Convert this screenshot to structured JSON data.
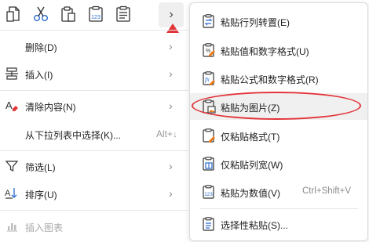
{
  "toolbar": {
    "icons": [
      "paste-icon",
      "cut-icon",
      "clipboard-icon",
      "paste-values-icon",
      "paste-formats-icon",
      "more-chevron-icon"
    ]
  },
  "menu": {
    "delete": {
      "label": "删除(D)"
    },
    "insert": {
      "label": "插入(I)"
    },
    "clear": {
      "label": "清除内容(N)"
    },
    "pick_from_list": {
      "label": "从下拉列表中选择(K)...",
      "shortcut": "Alt+↓"
    },
    "filter": {
      "label": "筛选(L)"
    },
    "sort": {
      "label": "排序(U)"
    },
    "insert_chart": {
      "label": "插入图表"
    }
  },
  "submenu": {
    "items": [
      {
        "label": "粘贴行列转置(E)"
      },
      {
        "label": "粘贴值和数字格式(U)"
      },
      {
        "label": "粘贴公式和数字格式(R)"
      },
      {
        "label": "粘贴为图片(Z)"
      },
      {
        "label": "仅粘贴格式(T)"
      },
      {
        "label": "仅粘贴列宽(W)"
      },
      {
        "label": "粘贴为数值(V)",
        "shortcut": "Ctrl+Shift+V"
      },
      {
        "label": "选择性粘贴(S)..."
      }
    ]
  },
  "colors": {
    "accent_red": "#e2353a",
    "icon_orange": "#e97a16",
    "icon_blue": "#2a6ccd"
  }
}
